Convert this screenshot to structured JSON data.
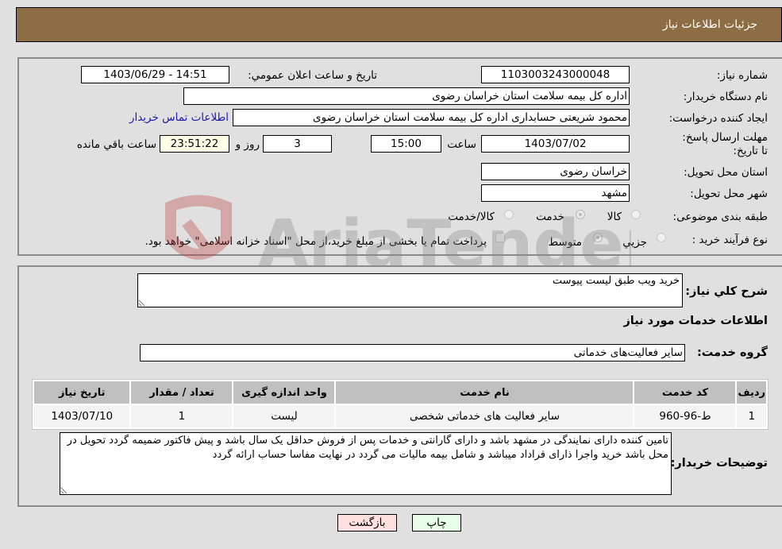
{
  "header": {
    "title": "جزئیات اطلاعات نیاز"
  },
  "fields": {
    "need_number": {
      "label": "شماره نیاز:",
      "value": "1103003243000048"
    },
    "announce_datetime": {
      "label": "تاریخ و ساعت اعلان عمومي:",
      "value": "1403/06/29 - 14:51"
    },
    "buyer_org": {
      "label": "نام دستگاه خریدار:",
      "value": "اداره کل بیمه سلامت استان خراسان رضوی"
    },
    "requester": {
      "label": "ایجاد کننده درخواست:",
      "value": "محمود شریعتی حسابداری اداره کل بیمه سلامت استان خراسان رضوی",
      "contact_link": "اطلاعات تماس خریدار"
    },
    "deadline": {
      "label": "مهلت ارسال پاسخ: تا تاریخ:",
      "date": "1403/07/02",
      "time_label": "ساعت",
      "time": "15:00",
      "days": "3",
      "days_label": "روز و",
      "remaining": "23:51:22",
      "remaining_label": "ساعت باقي مانده"
    },
    "delivery_province": {
      "label": "استان محل تحویل:",
      "value": "خراسان رضوی"
    },
    "delivery_city": {
      "label": "شهر محل تحویل:",
      "value": "مشهد"
    },
    "category": {
      "label": "طبقه بندی موضوعی:",
      "options": [
        {
          "label": "کالا",
          "checked": false
        },
        {
          "label": "خدمت",
          "checked": true
        },
        {
          "label": "کالا/خدمت",
          "checked": false
        }
      ]
    },
    "purchase_type": {
      "label": "نوع فرآیند خرید :",
      "options": [
        {
          "label": "جزيي",
          "checked": false
        },
        {
          "label": "متوسط",
          "checked": true
        }
      ],
      "treasury_note": "پرداخت تمام یا بخشی از مبلغ خرید،از محل \"اسناد خزانه اسلامی\" خواهد بود."
    }
  },
  "general_description": {
    "label": "شرح کلي نياز:",
    "value": "خرید ویب طبق لیست پیوست"
  },
  "services_section": {
    "title": "اطلاعات خدمات مورد نیاز",
    "group_label": "گروه خدمت:",
    "group_value": "سایر فعالیت‌های خدماتی",
    "table": {
      "headers": [
        "ردیف",
        "کد خدمت",
        "نام خدمت",
        "واحد اندازه گیری",
        "تعداد / مقدار",
        "تاریخ نیاز"
      ],
      "rows": [
        [
          "1",
          "ط-96-960",
          "سایر فعالیت های خدماتی شخصی",
          "لیست",
          "1",
          "1403/07/10"
        ]
      ]
    }
  },
  "buyer_notes": {
    "label": "توضیحات خریدار:",
    "value": "تامین کننده دارای نمایندگی در مشهد باشد و دارای گارانتی و خدمات پس از فروش حداقل یک سال باشد و پیش فاکتور ضمیمه گردد تحویل در محل باشد خرید واجرا ذارای قراداد میباشد و شامل بیمه مالیات می گردد در نهایت مفاسا حساب ارائه گردد"
  },
  "buttons": {
    "print": "چاپ",
    "back": "بازگشت"
  },
  "watermark": {
    "text": "AriaTender.neT"
  }
}
